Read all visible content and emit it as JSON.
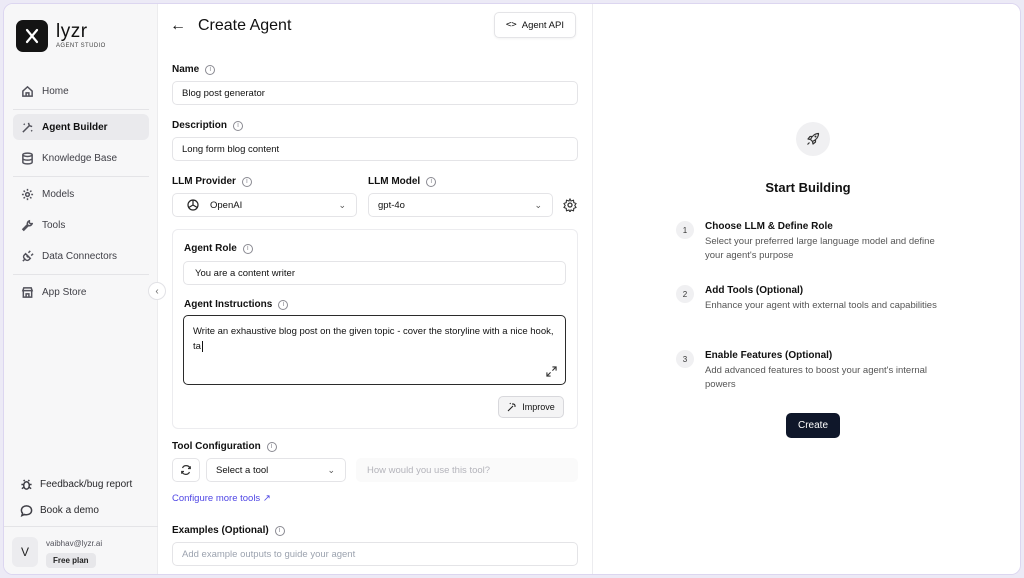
{
  "brand": {
    "name": "lyzr",
    "subtitle": "AGENT STUDIO"
  },
  "sidebar": {
    "items": [
      {
        "label": "Home",
        "icon": "home-icon"
      },
      {
        "label": "Agent Builder",
        "icon": "agent-builder-icon",
        "active": true
      },
      {
        "label": "Knowledge Base",
        "icon": "database-icon"
      },
      {
        "label": "Models",
        "icon": "models-icon"
      },
      {
        "label": "Tools",
        "icon": "wrench-icon"
      },
      {
        "label": "Data Connectors",
        "icon": "plug-icon"
      },
      {
        "label": "App Store",
        "icon": "store-icon"
      }
    ],
    "feedback_label": "Feedback/bug report",
    "demo_label": "Book a demo",
    "user": {
      "initial": "V",
      "email": "vaibhav@lyzr.ai",
      "plan": "Free plan"
    }
  },
  "header": {
    "title": "Create Agent",
    "api_button": "Agent API",
    "api_code_glyph": "<>"
  },
  "form": {
    "name": {
      "label": "Name",
      "value": "Blog post generator"
    },
    "description": {
      "label": "Description",
      "value": "Long form blog content"
    },
    "llm_provider": {
      "label": "LLM Provider",
      "value": "OpenAI"
    },
    "llm_model": {
      "label": "LLM Model",
      "value": "gpt-4o"
    },
    "agent_role": {
      "label": "Agent Role",
      "value": "You are a content writer"
    },
    "agent_instructions": {
      "label": "Agent Instructions",
      "value": "Write an exhaustive blog post on the given topic - cover the storyline with a nice hook, ta"
    },
    "improve_button": "Improve",
    "tool_configuration": {
      "label": "Tool Configuration",
      "select_value": "Select a tool",
      "usage_placeholder": "How would you use this tool?"
    },
    "configure_link": "Configure more tools ↗",
    "examples": {
      "label": "Examples (Optional)",
      "placeholder": "Add example outputs to guide your agent"
    }
  },
  "right_panel": {
    "title": "Start Building",
    "steps": [
      {
        "num": "1",
        "title": "Choose LLM & Define Role",
        "desc": "Select your preferred large language model and define your agent's purpose"
      },
      {
        "num": "2",
        "title": "Add Tools (Optional)",
        "desc": "Enhance your agent with external tools and capabilities"
      },
      {
        "num": "3",
        "title": "Enable Features (Optional)",
        "desc": "Add advanced features to boost your agent's internal powers"
      }
    ],
    "create_button": "Create"
  },
  "colors": {
    "accent_link": "#4f46e5",
    "primary_button": "#0f172a",
    "frame_border": "#dcd6f0"
  }
}
